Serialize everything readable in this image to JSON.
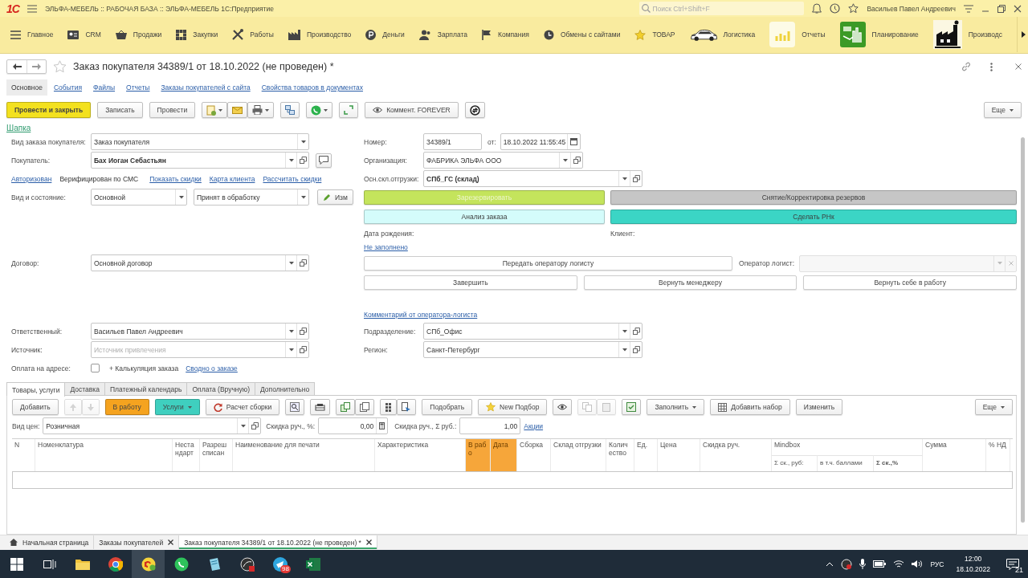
{
  "window": {
    "logo": "1С",
    "title": "ЭЛЬФА-МЕБЕЛЬ :: РАБОЧАЯ БАЗА :: ЭЛЬФА-МЕБЕЛЬ 1С:Предприятие",
    "search_placeholder": "Поиск Ctrl+Shift+F",
    "user": "Васильев Павел Андреевич"
  },
  "sections": [
    {
      "label": "Главное"
    },
    {
      "label": "CRM"
    },
    {
      "label": "Продажи"
    },
    {
      "label": "Закупки"
    },
    {
      "label": "Работы"
    },
    {
      "label": "Производство"
    },
    {
      "label": "Деньги"
    },
    {
      "label": "Зарплата"
    },
    {
      "label": "Компания"
    },
    {
      "label": "Обмены с сайтами"
    },
    {
      "label": "ТОВАР"
    },
    {
      "label": "Логистика"
    },
    {
      "label": "Отчеты"
    },
    {
      "label": "Планирование"
    },
    {
      "label": "Производс"
    }
  ],
  "document": {
    "title": "Заказ покупателя 34389/1 от 18.10.2022 (не проведен) *",
    "nav": [
      {
        "label": "Основное",
        "selected": true
      },
      {
        "label": "События",
        "selected": false
      },
      {
        "label": "Файлы",
        "selected": false
      },
      {
        "label": "Отчеты",
        "selected": false
      },
      {
        "label": "Заказы покупателей с сайта",
        "selected": false
      },
      {
        "label": "Свойства товаров в документах",
        "selected": false
      }
    ],
    "toolbar": [
      {
        "kind": "button",
        "label": "Провести и закрыть",
        "color": "#f3e11f"
      },
      {
        "kind": "button",
        "label": "Записать"
      },
      {
        "kind": "button",
        "label": "Провести"
      },
      {
        "kind": "icons",
        "disabled": false
      },
      {
        "kind": "icons",
        "disabled": false
      },
      {
        "kind": "icons",
        "disabled": false
      },
      {
        "kind": "icons",
        "disabled": false
      },
      {
        "kind": "icon_button",
        "label": "Коммент. FOREVER"
      },
      {
        "kind": "icons",
        "disabled": false
      }
    ],
    "more": "Еще"
  },
  "form": {
    "group_link": "Шапка",
    "left": {
      "order_type": {
        "label": "Вид заказа покупателя:",
        "value": "Заказ покупателя",
        "dropdown": true
      },
      "buyer": {
        "label": "Покупатель:",
        "value": "Бах Иоган Себастьян",
        "bold": true,
        "dropdown": true,
        "open": true
      },
      "buyer_status": [
        {
          "kind": "link",
          "text": "Авторизован"
        },
        {
          "kind": "text",
          "text": "Верифицирован по СМС"
        },
        {
          "kind": "link",
          "text": "Показать скидки"
        },
        {
          "kind": "link",
          "text": "Карта клиента"
        },
        {
          "kind": "link",
          "text": "Рассчитать скидки"
        }
      ],
      "state": {
        "label": "Вид и состояние:",
        "kind_field": {
          "value": "Основной",
          "dropdown": true
        },
        "status_field": {
          "value": "Принят в обработку",
          "dropdown": true
        },
        "edit_button": "Изм"
      },
      "contract": {
        "label": "Договор:",
        "value": "Основной договор",
        "dropdown": true,
        "open": true
      },
      "responsible": {
        "label": "Ответственный:",
        "value": "Васильев Павел Андреевич",
        "dropdown": true,
        "open": true
      },
      "source": {
        "label": "Источник:",
        "placeholder": "Источник привлечения",
        "dropdown": true,
        "open": true
      },
      "payment": {
        "label": "Оплата на адресе:",
        "checked": false
      },
      "calculation": "+ Калькуляция заказа",
      "summary_link": "Сводно о заказе"
    },
    "right": {
      "number": {
        "label": "Номер:",
        "value": "34389/1"
      },
      "date": {
        "label": "от:",
        "value": "18.10.2022 11:55:45",
        "calendar": true
      },
      "organization": {
        "label": "Организация:",
        "value": "ФАБРИКА ЭЛЬФА ООО",
        "dropdown": true,
        "open": true
      },
      "warehouse": {
        "label": "Осн.скл.отгрузки:",
        "value": "СПб_ГС (склад)",
        "bold": true,
        "dropdown": true,
        "open": true
      },
      "actions": [
        {
          "label": "Зарезервировать",
          "color": "#c4e45c",
          "disabled": true
        },
        {
          "label": "Снятие/Корректировка резервов",
          "color": "#c6c6c6",
          "disabled": false
        },
        {
          "label": "Анализ заказа",
          "color": "#d4fcfb",
          "disabled": false
        },
        {
          "label": "Сделать РНк",
          "color": "#3bd5c5",
          "disabled": false
        }
      ],
      "birth_date": {
        "label": "Дата рождения:",
        "link": "Не заполнено"
      },
      "client": {
        "label": "Клиент:"
      },
      "logist_button": "Передать оператору логисту",
      "operator": {
        "label": "Оператор логист:",
        "dropdown": true,
        "clear": true,
        "disabled": true
      },
      "buttons": [
        "Завершить",
        "Вернуть менеджеру",
        "Вернуть себе в работу"
      ],
      "comment_link": "Комментарий от оператора-логиста",
      "department": {
        "label": "Подразделение:",
        "value": "СПб_Офис",
        "dropdown": true,
        "open": true
      },
      "region": {
        "label": "Регион:",
        "value": "Санкт-Петербург",
        "dropdown": true,
        "open": true
      }
    }
  },
  "goods": {
    "tabs": [
      {
        "label": "Товары, услуги",
        "selected": true
      },
      {
        "label": "Доставка",
        "selected": false
      },
      {
        "label": "Платежный календарь",
        "selected": false
      },
      {
        "label": "Оплата (Вручную)",
        "selected": false
      },
      {
        "label": "Дополнительно",
        "selected": false
      }
    ],
    "toolbar": [
      {
        "kind": "button",
        "label": "Добавить"
      },
      {
        "kind": "icons",
        "disabled": true
      },
      {
        "kind": "button",
        "label": "В работу",
        "color": "#f5a31f"
      },
      {
        "kind": "button",
        "label": "Услуги",
        "color": "#3fcfbf",
        "dropdown": true
      },
      {
        "kind": "icon_button",
        "label": "Расчет сборки"
      },
      {
        "kind": "icons",
        "disabled": false
      },
      {
        "kind": "icons",
        "disabled": false
      },
      {
        "kind": "icons",
        "disabled": false
      },
      {
        "kind": "icons",
        "disabled": false
      },
      {
        "kind": "button",
        "label": "Подобрать"
      },
      {
        "kind": "icon_button",
        "label": "New Подбор"
      },
      {
        "kind": "icons",
        "disabled": false
      },
      {
        "kind": "icons",
        "disabled": true
      },
      {
        "kind": "icons",
        "disabled": false
      },
      {
        "kind": "button",
        "label": "Заполнить",
        "dropdown": true
      },
      {
        "kind": "icon_button",
        "label": "Добавить набор"
      },
      {
        "kind": "button",
        "label": "Изменить"
      }
    ],
    "more": "Еще",
    "price_type": {
      "label": "Вид цен:",
      "value": "Розничная",
      "dropdown": true,
      "open": true
    },
    "discount_percent": {
      "label": "Скидка руч., %:",
      "value": "0,00",
      "calculator": true
    },
    "discount_sum": {
      "label": "Скидка руч., Σ руб.:",
      "value": "1,00"
    },
    "promo_link": "Акции",
    "columns": [
      {
        "label": "N",
        "highlighted": false
      },
      {
        "label": "Номенклатура",
        "highlighted": false
      },
      {
        "label": "Нестандарт",
        "highlighted": false
      },
      {
        "label": "Разреш списан",
        "highlighted": false
      },
      {
        "label": "Наименование для печати",
        "highlighted": false
      },
      {
        "label": "Характеристика",
        "highlighted": false
      },
      {
        "label": "В рабо",
        "highlighted": true
      },
      {
        "label": "Дата",
        "highlighted": true
      },
      {
        "label": "Сборка",
        "highlighted": false
      },
      {
        "label": "Склад отгрузки",
        "highlighted": false
      },
      {
        "label": "Количество",
        "highlighted": false
      },
      {
        "label": "Ед.",
        "highlighted": false
      },
      {
        "label": "Цена",
        "highlighted": false
      },
      {
        "label": "Скидка руч.",
        "highlighted": false
      },
      {
        "label": "Mindbox",
        "highlighted": false,
        "subcolumns": [
          {
            "label": "Σ ск., руб:"
          },
          {
            "label": "в т.ч. баллами"
          },
          {
            "label": "Σ ск.,%",
            "bold": true
          }
        ]
      },
      {
        "label": "Сумма",
        "highlighted": false
      },
      {
        "label": "% НД",
        "highlighted": false
      }
    ]
  },
  "open_windows": [
    {
      "kind": "home",
      "label": "Начальная страница",
      "selected": false
    },
    {
      "kind": "window",
      "label": "Заказы покупателей",
      "selected": false
    },
    {
      "kind": "window",
      "label": "Заказ покупателя 34389/1 от 18.10.2022 (не проведен) *",
      "selected": true
    }
  ],
  "taskbar": {
    "apps": [
      {
        "selected": false
      },
      {
        "selected": false
      },
      {
        "selected": true
      },
      {
        "selected": false
      },
      {
        "selected": false
      },
      {
        "selected": false
      },
      {
        "selected": false,
        "badge": "98"
      },
      {
        "selected": false
      }
    ],
    "language": "РУС",
    "time": "12:00",
    "date": "18.10.2022",
    "notifications": "21"
  }
}
